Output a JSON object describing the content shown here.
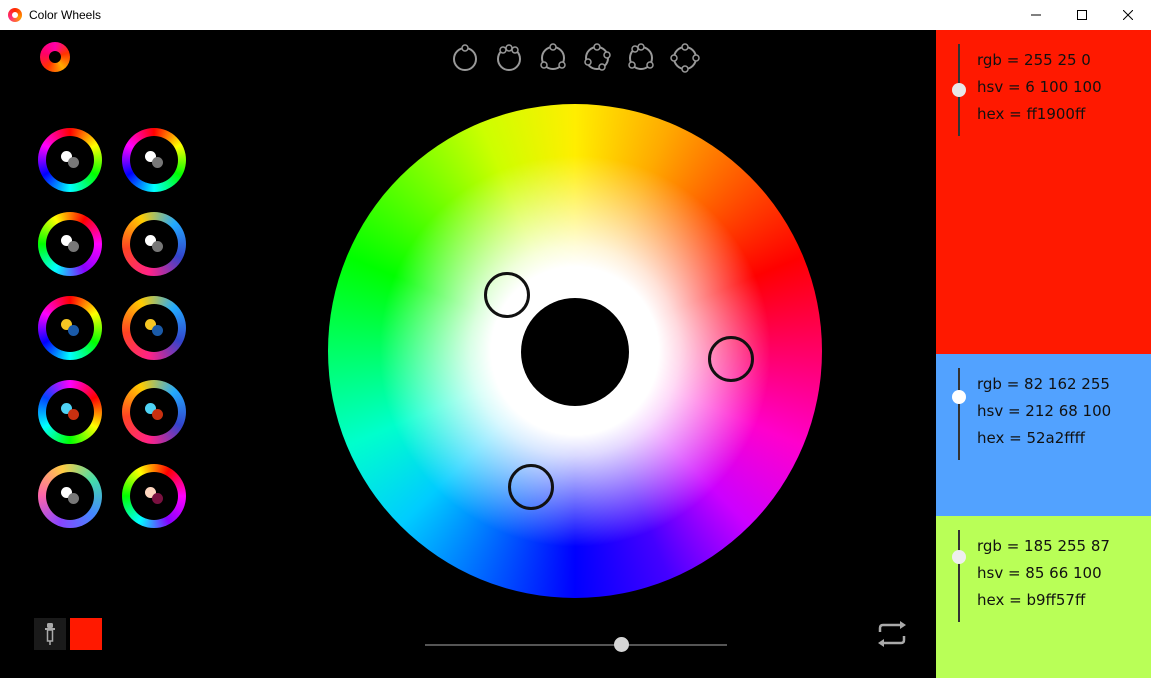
{
  "window": {
    "title": "Color Wheels",
    "controls": [
      "minimize-icon",
      "maximize-icon",
      "close-icon"
    ]
  },
  "toolbar": {
    "logo_icon": "color-wheel-logo-icon",
    "harmony_modes": [
      {
        "name": "monochromatic-icon"
      },
      {
        "name": "analogous-icon"
      },
      {
        "name": "complementary-icon"
      },
      {
        "name": "triadic-icon"
      },
      {
        "name": "split-complementary-icon"
      },
      {
        "name": "tetradic-icon"
      }
    ]
  },
  "presets": [
    {
      "ring": "p1",
      "dots": [
        "#ffffff",
        "#777777"
      ]
    },
    {
      "ring": "p1",
      "dots": [
        "#ffffff",
        "#777777"
      ]
    },
    {
      "ring": "p2",
      "dots": [
        "#ffffff",
        "#777777"
      ]
    },
    {
      "ring": "p4",
      "dots": [
        "#ffffff",
        "#777777"
      ]
    },
    {
      "ring": "p1",
      "dots": [
        "#f5c623",
        "#1a5aa8"
      ]
    },
    {
      "ring": "p4",
      "dots": [
        "#f5c623",
        "#1a5aa8"
      ]
    },
    {
      "ring": "p3",
      "dots": [
        "#4fd3f5",
        "#c83010"
      ]
    },
    {
      "ring": "p4",
      "dots": [
        "#4fd3f5",
        "#c83010"
      ]
    },
    {
      "ring": "p5",
      "dots": [
        "#ffffff",
        "#777777"
      ]
    },
    {
      "ring": "p2",
      "dots": [
        "#ffd6c0",
        "#7a1040"
      ]
    }
  ],
  "wheel": {
    "handles": [
      {
        "name": "wheel-handle-red",
        "color": "#ff1900"
      },
      {
        "name": "wheel-handle-blue",
        "color": "#52a2ff"
      },
      {
        "name": "wheel-handle-green",
        "color": "#b9ff57"
      }
    ]
  },
  "bottom": {
    "eyedropper_icon": "eyedropper-icon",
    "current_color": "#ff1900",
    "brightness_slider": 0.65,
    "refresh_icon": "refresh-icon"
  },
  "swatches": [
    {
      "color": "#ff1900",
      "knob_color": "#e8e8e8",
      "rgb": "rgb = 255 25 0",
      "hsv": "hsv = 6 100 100",
      "hex": "hex = ff1900ff"
    },
    {
      "color": "#52a2ff",
      "knob_color": "#ffffff",
      "rgb": "rgb = 82 162 255",
      "hsv": "hsv = 212 68 100",
      "hex": "hex = 52a2ffff"
    },
    {
      "color": "#b9ff57",
      "knob_color": "#eeeeee",
      "rgb": "rgb = 185 255 87",
      "hsv": "hsv = 85 66 100",
      "hex": "hex = b9ff57ff"
    }
  ]
}
